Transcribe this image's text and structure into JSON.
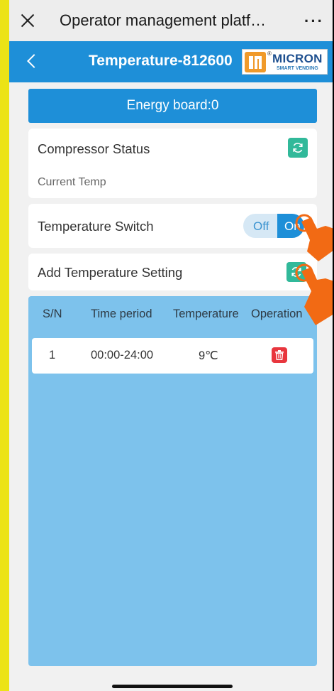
{
  "topbar": {
    "close_icon": "close-icon",
    "title": "Operator management platf…",
    "more": "···"
  },
  "header": {
    "back_icon": "chevron-left-icon",
    "title": "Temperature-812600",
    "logo": {
      "brand": "MICRON",
      "registered": "®",
      "tagline": "SMART VENDING"
    }
  },
  "energy": {
    "label": "Energy board:0"
  },
  "compressor": {
    "label": "Compressor Status",
    "current_temp_label": "Current Temp",
    "refresh_icon": "refresh-icon"
  },
  "temperature_switch": {
    "label": "Temperature Switch",
    "off_label": "Off",
    "on_label": "On"
  },
  "add_setting": {
    "label": "Add Temperature Setting",
    "refresh_icon": "refresh-icon"
  },
  "table": {
    "headers": [
      "S/N",
      "Time period",
      "Temperature",
      "Operation"
    ],
    "rows": [
      {
        "sn": "1",
        "time_period": "00:00-24:00",
        "temperature": "9℃",
        "operation_icon": "trash-icon"
      }
    ]
  },
  "colors": {
    "primary": "#1e8fd8",
    "refresh": "#31b99a",
    "delete": "#e8363e",
    "table_bg": "#7dc2ec",
    "frame": "#ece316",
    "hand": "#f26a14"
  }
}
